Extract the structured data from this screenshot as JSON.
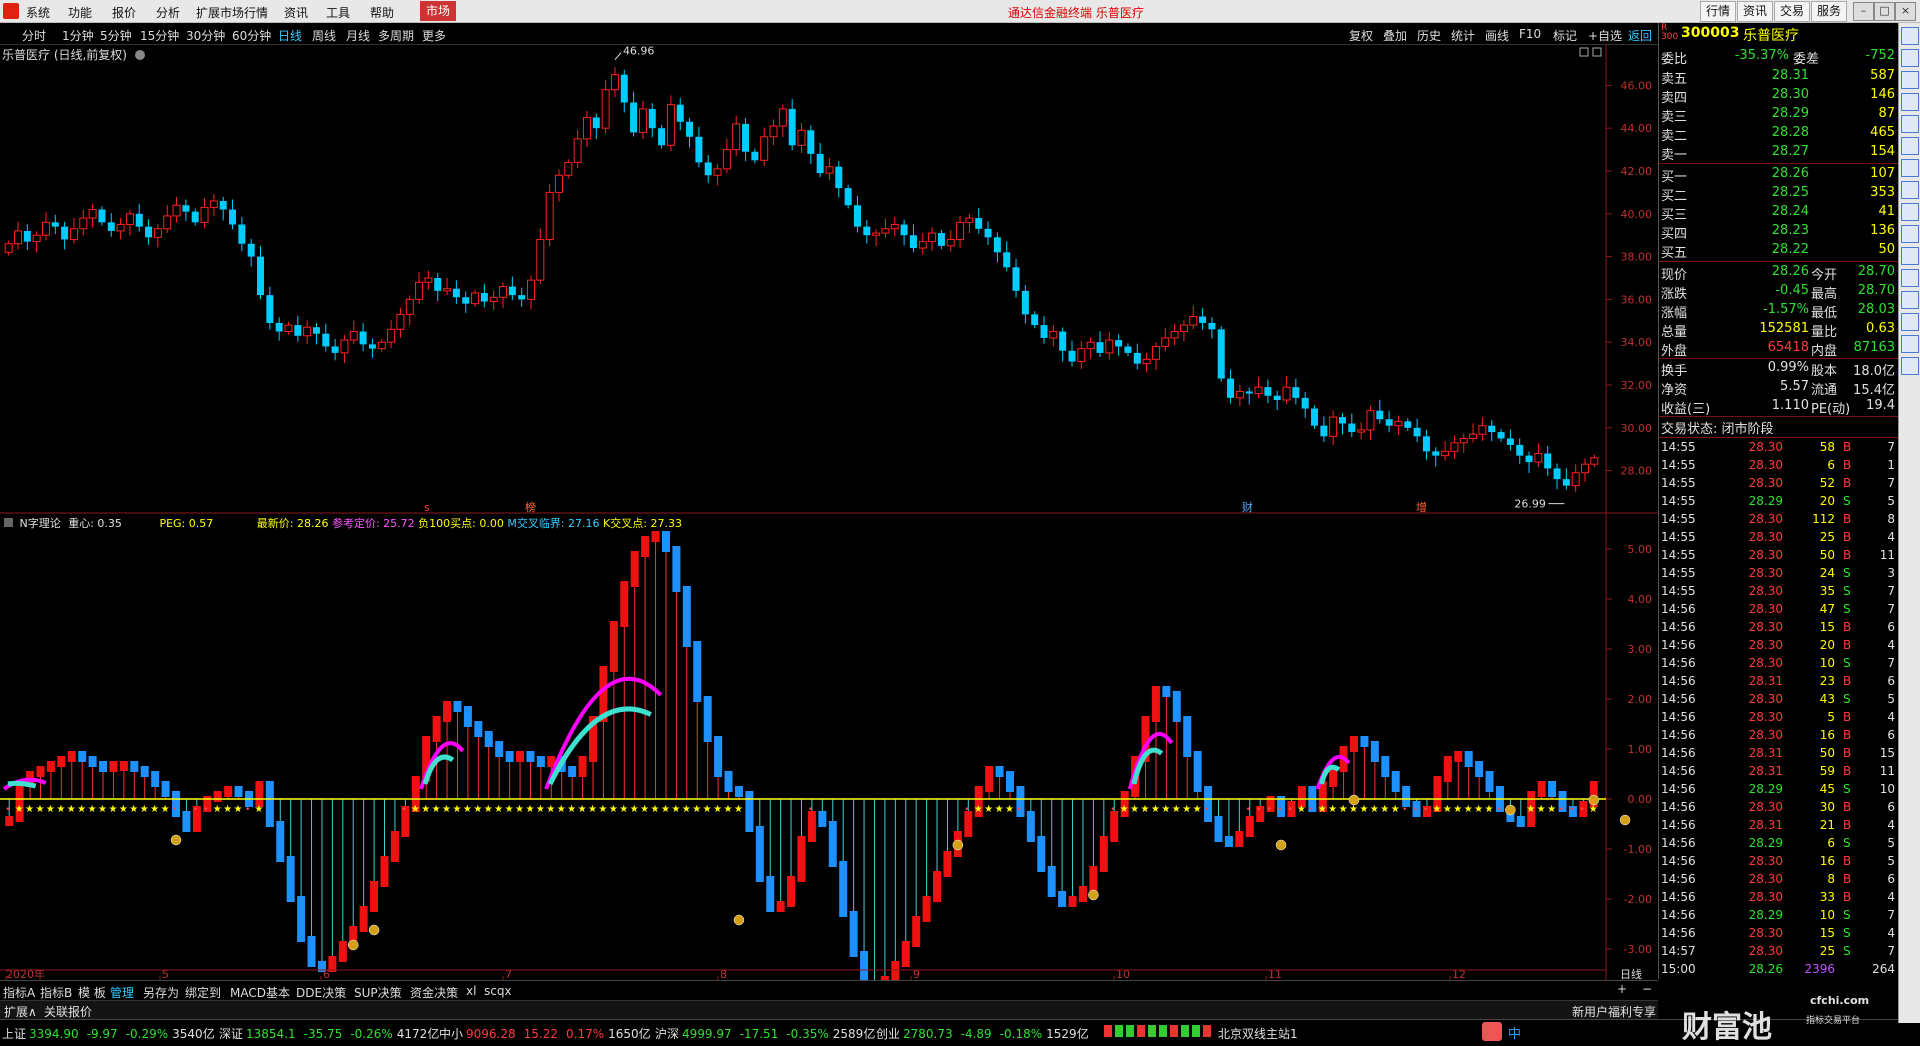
{
  "menu": {
    "items": [
      "系统",
      "功能",
      "报价",
      "分析",
      "扩展市场行情",
      "资讯",
      "工具",
      "帮助"
    ],
    "market": "市场",
    "center_title": "通达信金融终端  乐普医疗",
    "right_buttons": [
      "行情",
      "资讯",
      "交易",
      "服务"
    ]
  },
  "periods": {
    "items": [
      "分时",
      "1分钟",
      "5分钟",
      "15分钟",
      "30分钟",
      "60分钟",
      "日线",
      "周线",
      "月线",
      "多周期",
      "更多"
    ],
    "active": "日线"
  },
  "tools": {
    "items": [
      "复权",
      "叠加",
      "历史",
      "统计",
      "画线",
      "F10",
      "标记",
      "+自选",
      "返回"
    ],
    "active": "返回"
  },
  "chart": {
    "title": "乐普医疗 (日线,前复权)",
    "high_label": "46.96",
    "low_label": "26.99",
    "price_axis": [
      "46.00",
      "44.00",
      "42.00",
      "40.00",
      "38.00",
      "36.00",
      "34.00",
      "32.00",
      "30.00",
      "28.00"
    ],
    "ind_axis": [
      "5.00",
      "4.00",
      "3.00",
      "2.00",
      "1.00",
      "0.00",
      "-1.00",
      "-2.00",
      "-3.00"
    ],
    "markers": [
      {
        "text": "s",
        "color": "#ff4444"
      },
      {
        "text": "榜",
        "color": "#ff6633"
      },
      {
        "text": "财",
        "color": "#55aaff"
      },
      {
        "text": "增",
        "color": "#ff6633"
      }
    ],
    "date_axis": [
      "2020年",
      "5",
      "6",
      "7",
      "8",
      "9",
      "10",
      "11",
      "12"
    ],
    "period_label": "日线",
    "zoom_buttons": [
      "+",
      "−"
    ]
  },
  "indicator": {
    "name": "N字理论",
    "focus": "重心: 0.35",
    "peg": "PEG: 0.57",
    "latest": "最新价: 28.26",
    "ref": "参考定价: 25.72",
    "neg": "负100买点: 0.00",
    "m": "M交叉临界: 27.16",
    "k": "K交叉点: 27.33"
  },
  "quote": {
    "badge": "R 300",
    "code": "300003",
    "name": "乐普医疗",
    "weibi_label": "委比",
    "weibi": "-35.37%",
    "weicha_label": "委差",
    "weicha": "-752",
    "sell": [
      {
        "label": "卖五",
        "price": "28.31",
        "vol": "587"
      },
      {
        "label": "卖四",
        "price": "28.30",
        "vol": "146"
      },
      {
        "label": "卖三",
        "price": "28.29",
        "vol": "87"
      },
      {
        "label": "卖二",
        "price": "28.28",
        "vol": "465"
      },
      {
        "label": "卖一",
        "price": "28.27",
        "vol": "154"
      }
    ],
    "buy": [
      {
        "label": "买一",
        "price": "28.26",
        "vol": "107"
      },
      {
        "label": "买二",
        "price": "28.25",
        "vol": "353"
      },
      {
        "label": "买三",
        "price": "28.24",
        "vol": "41"
      },
      {
        "label": "买四",
        "price": "28.23",
        "vol": "136"
      },
      {
        "label": "买五",
        "price": "28.22",
        "vol": "50"
      }
    ],
    "stats": [
      {
        "l1": "现价",
        "v1": "28.26",
        "c1": "green",
        "l2": "今开",
        "v2": "28.70",
        "c2": "green"
      },
      {
        "l1": "涨跌",
        "v1": "-0.45",
        "c1": "green",
        "l2": "最高",
        "v2": "28.70",
        "c2": "green"
      },
      {
        "l1": "涨幅",
        "v1": "-1.57%",
        "c1": "green",
        "l2": "最低",
        "v2": "28.03",
        "c2": "green"
      },
      {
        "l1": "总量",
        "v1": "152581",
        "c1": "yellow",
        "l2": "量比",
        "v2": "0.63",
        "c2": "yellow"
      },
      {
        "l1": "外盘",
        "v1": "65418",
        "c1": "red",
        "l2": "内盘",
        "v2": "87163",
        "c2": "green"
      },
      {
        "l1": "换手",
        "v1": "0.99%",
        "c1": "white",
        "l2": "股本",
        "v2": "18.0亿",
        "c2": "white"
      },
      {
        "l1": "净资",
        "v1": "5.57",
        "c1": "white",
        "l2": "流通",
        "v2": "15.4亿",
        "c2": "white"
      },
      {
        "l1": "收益(三)",
        "v1": "1.110",
        "c1": "white",
        "l2": "PE(动)",
        "v2": "19.4",
        "c2": "white"
      }
    ],
    "trade_status": "交易状态: 闭市阶段",
    "ticks": [
      {
        "t": "14:55",
        "p": "28.30",
        "v": "58",
        "bs": "B",
        "n": "7"
      },
      {
        "t": "14:55",
        "p": "28.30",
        "v": "6",
        "bs": "B",
        "n": "1"
      },
      {
        "t": "14:55",
        "p": "28.30",
        "v": "52",
        "bs": "B",
        "n": "7"
      },
      {
        "t": "14:55",
        "p": "28.29",
        "v": "20",
        "bs": "S",
        "n": "5"
      },
      {
        "t": "14:55",
        "p": "28.30",
        "v": "112",
        "bs": "B",
        "n": "8"
      },
      {
        "t": "14:55",
        "p": "28.30",
        "v": "25",
        "bs": "B",
        "n": "4"
      },
      {
        "t": "14:55",
        "p": "28.30",
        "v": "50",
        "bs": "B",
        "n": "11"
      },
      {
        "t": "14:55",
        "p": "28.30",
        "v": "24",
        "bs": "S",
        "n": "3"
      },
      {
        "t": "14:55",
        "p": "28.30",
        "v": "35",
        "bs": "S",
        "n": "7"
      },
      {
        "t": "14:56",
        "p": "28.30",
        "v": "47",
        "bs": "S",
        "n": "7"
      },
      {
        "t": "14:56",
        "p": "28.30",
        "v": "15",
        "bs": "B",
        "n": "6"
      },
      {
        "t": "14:56",
        "p": "28.30",
        "v": "20",
        "bs": "B",
        "n": "4"
      },
      {
        "t": "14:56",
        "p": "28.30",
        "v": "10",
        "bs": "S",
        "n": "7"
      },
      {
        "t": "14:56",
        "p": "28.31",
        "v": "23",
        "bs": "B",
        "n": "6"
      },
      {
        "t": "14:56",
        "p": "28.30",
        "v": "43",
        "bs": "S",
        "n": "5"
      },
      {
        "t": "14:56",
        "p": "28.30",
        "v": "5",
        "bs": "B",
        "n": "4"
      },
      {
        "t": "14:56",
        "p": "28.30",
        "v": "16",
        "bs": "B",
        "n": "6"
      },
      {
        "t": "14:56",
        "p": "28.31",
        "v": "50",
        "bs": "B",
        "n": "15"
      },
      {
        "t": "14:56",
        "p": "28.31",
        "v": "59",
        "bs": "B",
        "n": "11"
      },
      {
        "t": "14:56",
        "p": "28.29",
        "v": "45",
        "bs": "S",
        "n": "10"
      },
      {
        "t": "14:56",
        "p": "28.30",
        "v": "30",
        "bs": "B",
        "n": "6"
      },
      {
        "t": "14:56",
        "p": "28.31",
        "v": "21",
        "bs": "B",
        "n": "4"
      },
      {
        "t": "14:56",
        "p": "28.29",
        "v": "6",
        "bs": "S",
        "n": "5"
      },
      {
        "t": "14:56",
        "p": "28.30",
        "v": "16",
        "bs": "B",
        "n": "5"
      },
      {
        "t": "14:56",
        "p": "28.30",
        "v": "8",
        "bs": "B",
        "n": "6"
      },
      {
        "t": "14:56",
        "p": "28.30",
        "v": "33",
        "bs": "B",
        "n": "4"
      },
      {
        "t": "14:56",
        "p": "28.29",
        "v": "10",
        "bs": "S",
        "n": "7"
      },
      {
        "t": "14:56",
        "p": "28.30",
        "v": "15",
        "bs": "S",
        "n": "4"
      },
      {
        "t": "14:57",
        "p": "28.30",
        "v": "25",
        "bs": "S",
        "n": "7"
      },
      {
        "t": "15:00",
        "p": "28.26",
        "v": "2396",
        "bs": "",
        "n": "264"
      }
    ]
  },
  "tabs": {
    "items": [
      "指标A",
      "指标B",
      "模 板",
      "管理",
      "另存为",
      "绑定到",
      "MACD基本",
      "DDE决策",
      "SUP决策",
      "资金决策",
      "xl",
      "scqx"
    ],
    "active": "管理"
  },
  "ext": {
    "left": "扩展∧",
    "link": "关联报价"
  },
  "status": {
    "indices": [
      {
        "name": "上证",
        "val": "3394.90",
        "chg": "-9.97",
        "pct": "-0.29%",
        "amt": "3540亿",
        "color": "green"
      },
      {
        "name": "深证",
        "val": "13854.1",
        "chg": "-35.75",
        "pct": "-0.26%",
        "amt": "4172亿",
        "color": "green"
      },
      {
        "name": "中小",
        "val": "9096.28",
        "chg": "15.22",
        "pct": "0.17%",
        "amt": "1650亿",
        "color": "red"
      },
      {
        "name": "沪深",
        "val": "4999.97",
        "chg": "-17.51",
        "pct": "-0.35%",
        "amt": "2589亿",
        "color": "green"
      },
      {
        "name": "创业",
        "val": "2780.73",
        "chg": "-4.89",
        "pct": "-0.18%",
        "amt": "1529亿",
        "color": "green"
      }
    ],
    "server": "北京双线主站1",
    "promo": "新用户福利专享",
    "ime": "中",
    "watermark": "财富池",
    "watermark_url": "cfchi.com",
    "watermark_sub": "指标交易平台"
  },
  "colors": {
    "up": "#ff2020",
    "down": "#00ccff",
    "ma": "#ff00ff",
    "cyan": "#40e0d0",
    "star": "#ffff00"
  },
  "chart_data": {
    "type": "candlestick",
    "price_range": [
      27.0,
      47.0
    ],
    "indicator_range": [
      -3.5,
      5.3
    ],
    "closes": [
      38.6,
      39.2,
      38.7,
      39.0,
      39.6,
      39.4,
      38.8,
      39.3,
      39.8,
      40.2,
      39.6,
      39.2,
      39.5,
      40.0,
      39.4,
      38.9,
      39.3,
      39.9,
      40.4,
      40.1,
      39.6,
      40.3,
      40.6,
      40.2,
      39.5,
      38.6,
      38.0,
      36.2,
      34.9,
      34.5,
      34.8,
      34.3,
      34.7,
      34.4,
      33.8,
      33.5,
      34.1,
      34.5,
      33.9,
      33.7,
      34.0,
      34.6,
      35.3,
      36.0,
      36.8,
      37.0,
      36.4,
      36.5,
      36.1,
      35.8,
      36.3,
      35.9,
      36.1,
      36.6,
      36.2,
      36.0,
      36.9,
      38.8,
      41.0,
      41.8,
      42.4,
      43.5,
      44.5,
      44.0,
      45.8,
      46.5,
      45.2,
      43.8,
      44.9,
      44.0,
      43.2,
      45.1,
      44.3,
      43.6,
      42.4,
      41.8,
      42.1,
      43.0,
      44.2,
      42.9,
      42.5,
      43.6,
      44.1,
      44.9,
      43.2,
      43.9,
      42.8,
      41.9,
      42.2,
      41.2,
      40.4,
      39.4,
      39.0,
      39.1,
      39.3,
      39.5,
      39.0,
      38.4,
      38.7,
      39.1,
      38.5,
      38.8,
      39.6,
      39.8,
      39.3,
      38.9,
      38.2,
      37.5,
      36.4,
      35.3,
      34.8,
      34.2,
      34.5,
      33.6,
      33.1,
      33.7,
      34.0,
      33.5,
      34.1,
      33.8,
      33.5,
      33.0,
      33.2,
      33.8,
      34.2,
      34.5,
      34.8,
      35.2,
      34.9,
      34.6,
      32.3,
      31.4,
      31.7,
      31.6,
      31.9,
      31.5,
      31.3,
      31.9,
      31.4,
      30.9,
      30.1,
      29.6,
      30.5,
      30.2,
      29.8,
      29.9,
      30.8,
      30.4,
      30.1,
      30.3,
      30.0,
      29.6,
      28.9,
      28.7,
      28.9,
      29.3,
      29.5,
      29.7,
      30.1,
      29.8,
      29.5,
      29.2,
      28.7,
      28.4,
      28.8,
      28.1,
      27.6,
      27.3,
      27.9,
      28.3,
      28.6
    ],
    "indicator_values": [
      -0.4,
      0.3,
      0.5,
      0.6,
      0.7,
      0.8,
      0.9,
      0.8,
      0.7,
      0.6,
      0.7,
      0.7,
      0.6,
      0.5,
      0.3,
      0.1,
      -0.3,
      -0.6,
      -0.2,
      0.0,
      0.1,
      0.2,
      0.1,
      -0.1,
      0.3,
      -0.5,
      -1.2,
      -2.0,
      -2.8,
      -3.3,
      -3.4,
      -3.2,
      -2.9,
      -2.6,
      -2.2,
      -1.7,
      -1.2,
      -0.7,
      -0.2,
      0.4,
      1.2,
      1.6,
      1.9,
      1.8,
      1.5,
      1.3,
      1.1,
      0.9,
      0.8,
      0.9,
      0.8,
      0.7,
      0.8,
      0.6,
      0.5,
      0.8,
      1.6,
      2.6,
      3.5,
      4.3,
      4.9,
      5.2,
      5.3,
      5.0,
      4.2,
      3.1,
      2.0,
      1.2,
      0.5,
      0.2,
      0.1,
      -0.6,
      -1.6,
      -2.2,
      -2.1,
      -1.6,
      -0.8,
      -0.3,
      -0.5,
      -1.3,
      -2.3,
      -3.1,
      -3.7,
      -3.9,
      -3.6,
      -3.3,
      -2.9,
      -2.4,
      -2.0,
      -1.5,
      -1.1,
      -0.7,
      -0.3,
      0.2,
      0.6,
      0.5,
      0.2,
      -0.3,
      -0.8,
      -1.4,
      -1.9,
      -2.1,
      -2.0,
      -1.8,
      -1.4,
      -0.8,
      -0.3,
      0.1,
      0.8,
      1.6,
      2.2,
      2.1,
      1.6,
      0.9,
      0.2,
      -0.4,
      -0.8,
      -0.9,
      -0.7,
      -0.4,
      -0.2,
      0.0,
      -0.3,
      -0.1,
      0.2,
      -0.2,
      0.3,
      0.6,
      1.0,
      1.2,
      1.1,
      0.8,
      0.5,
      0.2,
      -0.1,
      -0.3,
      -0.2,
      0.4,
      0.8,
      0.9,
      0.7,
      0.5,
      0.2,
      -0.2,
      -0.4,
      -0.5,
      0.1,
      0.3,
      0.1,
      -0.2,
      -0.3,
      -0.1,
      0.3
    ]
  }
}
